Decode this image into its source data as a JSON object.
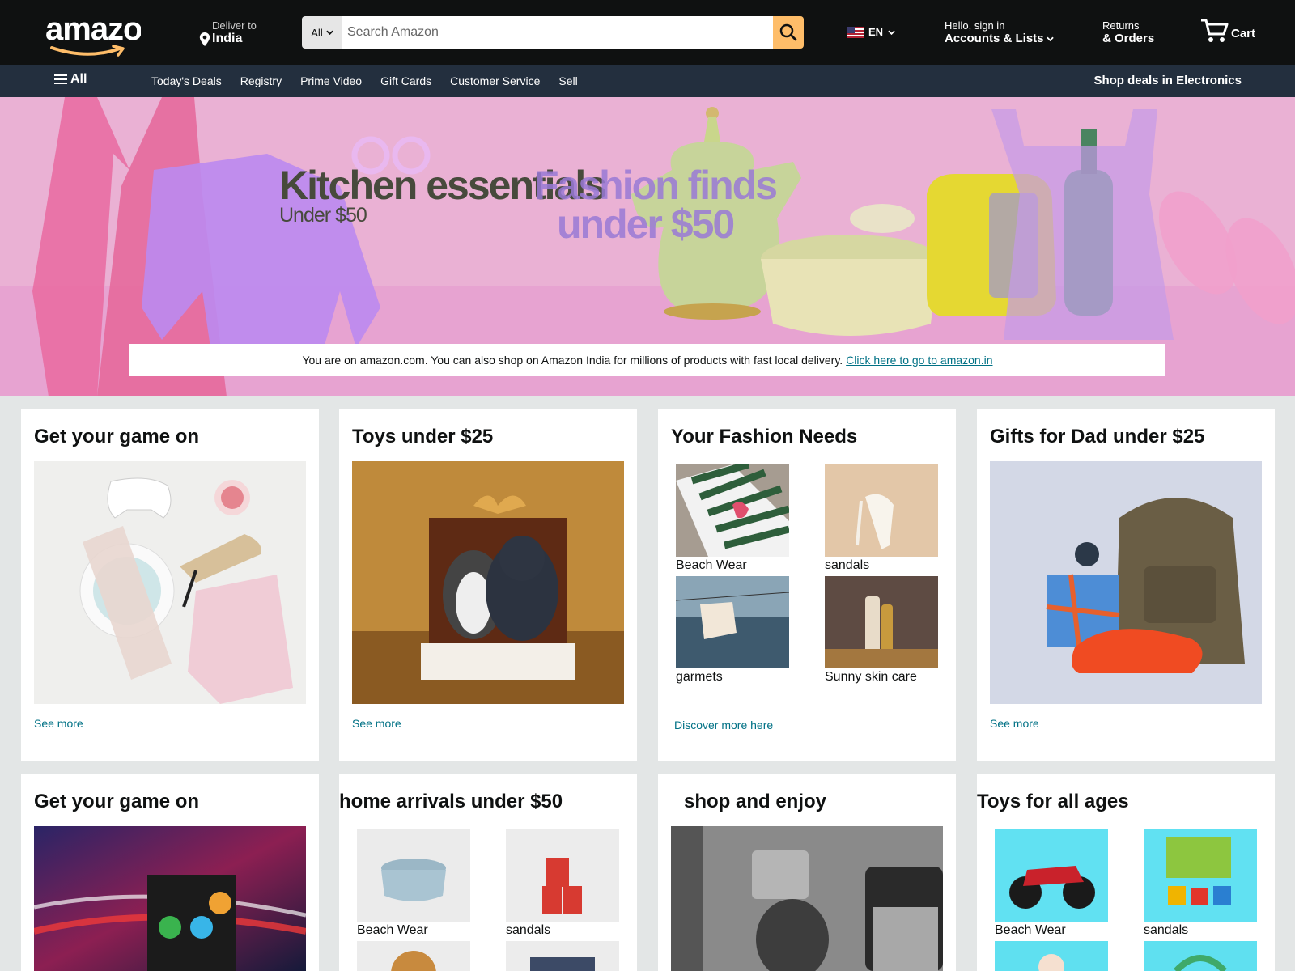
{
  "brand": {
    "logo_text": "amazon",
    "accent_color": "#febd69",
    "nav_bg": "#0f1111",
    "subnav_bg": "#232f3e",
    "link_color": "#007185"
  },
  "header": {
    "deliver_small": "Deliver to",
    "deliver_location": "India",
    "search_category": "All",
    "search_placeholder": "Search Amazon",
    "language": "EN",
    "account_small": "Hello, sign in",
    "account_big": "Accounts & Lists",
    "returns_small": "Returns",
    "returns_big": "& Orders",
    "cart_label": "Cart"
  },
  "subnav": {
    "all_label": "All",
    "links": [
      "Today's Deals",
      "Registry",
      "Prime Video",
      "Gift Cards",
      "Customer Service",
      "Sell"
    ],
    "promo": "Shop deals in Electronics"
  },
  "hero": {
    "title1": "Kitchen essentials",
    "subtitle1": "Under $50",
    "title2": "Fashion finds",
    "title2b": "under $50",
    "notice_text": "You are on amazon.com. You can also shop on Amazon India for millions of products with fast local delivery.",
    "notice_link": "Click here to go to amazon.in"
  },
  "cards_row1": [
    {
      "title": "Get your game on",
      "link": "See more"
    },
    {
      "title": "Toys under $25",
      "link": "See more"
    },
    {
      "title": "Your Fashion Needs",
      "link": "Discover more here",
      "items": [
        "Beach Wear",
        "sandals",
        "garmets",
        "Sunny skin care"
      ]
    },
    {
      "title": "Gifts for Dad under $25",
      "link": "See more"
    }
  ],
  "cards_row2": [
    {
      "title": "Get your game on"
    },
    {
      "title": "home arrivals under $50",
      "items": [
        "Beach Wear",
        "sandals"
      ]
    },
    {
      "title": "shop and enjoy"
    },
    {
      "title": "Toys for all ages",
      "items": [
        "Beach Wear",
        "sandals"
      ]
    }
  ]
}
